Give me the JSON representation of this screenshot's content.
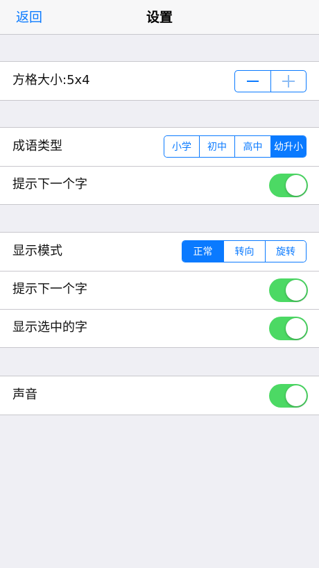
{
  "navbar": {
    "back_label": "返回",
    "title": "设置"
  },
  "grid_size": {
    "label": "方格大小:5x4"
  },
  "idiom": {
    "type_label": "成语类型",
    "type_options": [
      "小学",
      "初中",
      "高中",
      "幼升小"
    ],
    "type_selected": "幼升小",
    "hint_label": "提示下一个字",
    "hint_on": true
  },
  "display": {
    "mode_label": "显示模式",
    "mode_options": [
      "正常",
      "转向",
      "旋转"
    ],
    "mode_selected": "正常",
    "hint_label": "提示下一个字",
    "hint_on": true,
    "show_selected_label": "显示选中的字",
    "show_selected_on": true
  },
  "sound": {
    "label": "声音",
    "on": true
  },
  "colors": {
    "accent": "#0a7aff",
    "toggle_on": "#4cd964",
    "background": "#efeff4"
  }
}
